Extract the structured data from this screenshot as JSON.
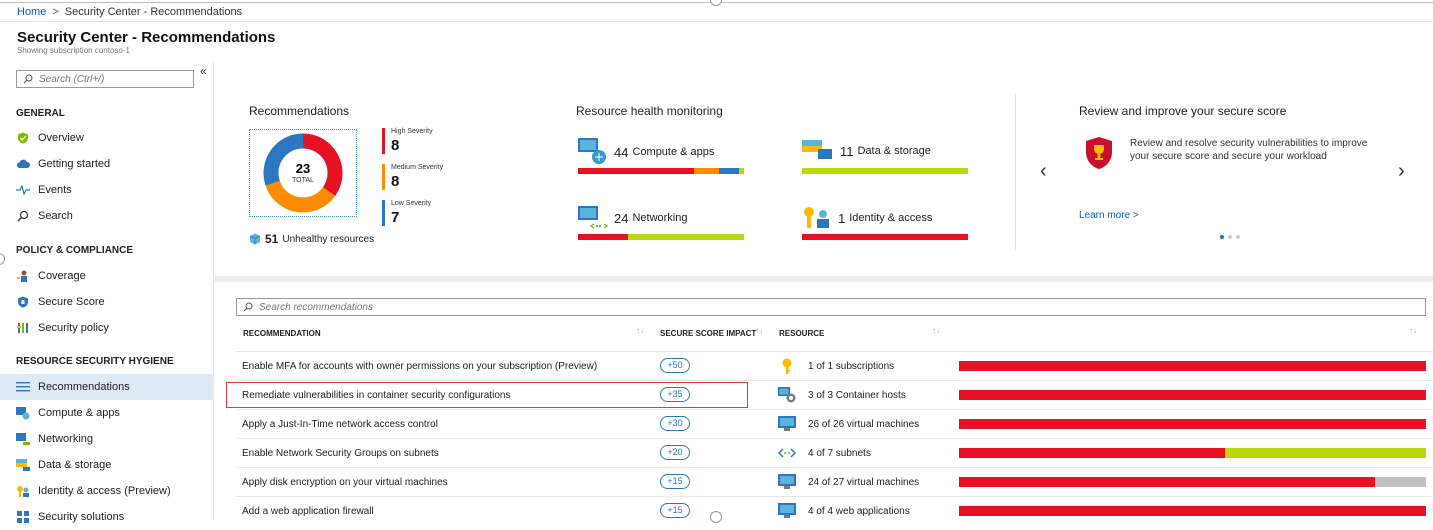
{
  "breadcrumb": {
    "home": "Home",
    "current": "Security Center - Recommendations"
  },
  "page": {
    "title": "Security Center - Recommendations",
    "subtitle": "Showing subscription contoso-1"
  },
  "sidebar": {
    "search_placeholder": "Search (Ctrl+/)",
    "collapse": "«",
    "sections": [
      {
        "title": "GENERAL",
        "items": [
          {
            "label": "Overview",
            "icon": "shield-check-icon"
          },
          {
            "label": "Getting started",
            "icon": "cloud-icon"
          },
          {
            "label": "Events",
            "icon": "pulse-icon"
          },
          {
            "label": "Search",
            "icon": "search-icon"
          }
        ]
      },
      {
        "title": "POLICY & COMPLIANCE",
        "items": [
          {
            "label": "Coverage",
            "icon": "coverage-icon"
          },
          {
            "label": "Secure Score",
            "icon": "shield-icon"
          },
          {
            "label": "Security policy",
            "icon": "policy-icon"
          }
        ]
      },
      {
        "title": "RESOURCE SECURITY HYGIENE",
        "items": [
          {
            "label": "Recommendations",
            "icon": "list-icon",
            "active": true
          },
          {
            "label": "Compute & apps",
            "icon": "compute-icon"
          },
          {
            "label": "Networking",
            "icon": "network-icon"
          },
          {
            "label": "Data & storage",
            "icon": "storage-icon"
          },
          {
            "label": "Identity & access (Preview)",
            "icon": "identity-icon"
          },
          {
            "label": "Security solutions",
            "icon": "grid-icon"
          }
        ]
      }
    ]
  },
  "recommendations_summary": {
    "title": "Recommendations",
    "total": "23",
    "total_label": "TOTAL",
    "severities": [
      {
        "label": "High Severity",
        "count": "8",
        "color": "#e81123"
      },
      {
        "label": "Medium Severity",
        "count": "8",
        "color": "#ff8c00"
      },
      {
        "label": "Low Severity",
        "count": "7",
        "color": "#2c77c0"
      }
    ],
    "unhealthy_count": "51",
    "unhealthy_label": "Unhealthy resources"
  },
  "resource_health": {
    "title": "Resource health monitoring",
    "items": [
      {
        "count": "44",
        "label": "Compute & apps",
        "segments": [
          {
            "pct": 70,
            "color": "#e81123"
          },
          {
            "pct": 15,
            "color": "#ff8c00"
          },
          {
            "pct": 12,
            "color": "#2c77c0"
          },
          {
            "pct": 3,
            "color": "#bad80a"
          }
        ]
      },
      {
        "count": "11",
        "label": "Data & storage",
        "segments": [
          {
            "pct": 100,
            "color": "#bad80a"
          }
        ]
      },
      {
        "count": "24",
        "label": "Networking",
        "segments": [
          {
            "pct": 30,
            "color": "#e81123"
          },
          {
            "pct": 70,
            "color": "#bad80a"
          }
        ]
      },
      {
        "count": "1",
        "label": "Identity & access",
        "segments": [
          {
            "pct": 100,
            "color": "#e81123"
          }
        ]
      }
    ]
  },
  "secure_score_promo": {
    "title": "Review and improve your secure score",
    "text": "Review and resolve security vulnerabilities to improve your secure score and secure your workload",
    "link": "Learn more >",
    "prev": "‹",
    "next": "›"
  },
  "recommendation_list": {
    "search_placeholder": "Search recommendations",
    "columns": {
      "recommendation": "RECOMMENDATION",
      "impact": "SECURE SCORE IMPACT",
      "resource": "RESOURCE"
    },
    "rows": [
      {
        "name": "Enable MFA for accounts with owner permissions on your subscription (Preview)",
        "impact": "+50",
        "resource": "1 of 1 subscriptions",
        "icon": "key-icon",
        "bars": [
          {
            "pct": 100,
            "color": "#e81123"
          }
        ]
      },
      {
        "name": "Remediate vulnerabilities in container security configurations",
        "impact": "+35",
        "resource": "3 of 3 Container hosts",
        "icon": "container-icon",
        "bars": [
          {
            "pct": 100,
            "color": "#e81123"
          }
        ]
      },
      {
        "name": "Apply a Just-In-Time network access control",
        "impact": "+30",
        "resource": "26 of 26 virtual machines",
        "icon": "vm-icon",
        "bars": [
          {
            "pct": 100,
            "color": "#e81123"
          }
        ]
      },
      {
        "name": "Enable Network Security Groups on subnets",
        "impact": "+20",
        "resource": "4 of 7 subnets",
        "icon": "subnet-icon",
        "bars": [
          {
            "pct": 57,
            "color": "#e81123"
          },
          {
            "pct": 43,
            "color": "#bad80a"
          }
        ]
      },
      {
        "name": "Apply disk encryption on your virtual machines",
        "impact": "+15",
        "resource": "24 of 27 virtual machines",
        "icon": "vm-icon",
        "bars": [
          {
            "pct": 89,
            "color": "#e81123"
          },
          {
            "pct": 11,
            "color": "#c1c1c1"
          }
        ]
      },
      {
        "name": "Add a web application firewall",
        "impact": "+15",
        "resource": "4 of 4 web applications",
        "icon": "vm-icon",
        "bars": [
          {
            "pct": 100,
            "color": "#e81123"
          }
        ]
      }
    ]
  }
}
